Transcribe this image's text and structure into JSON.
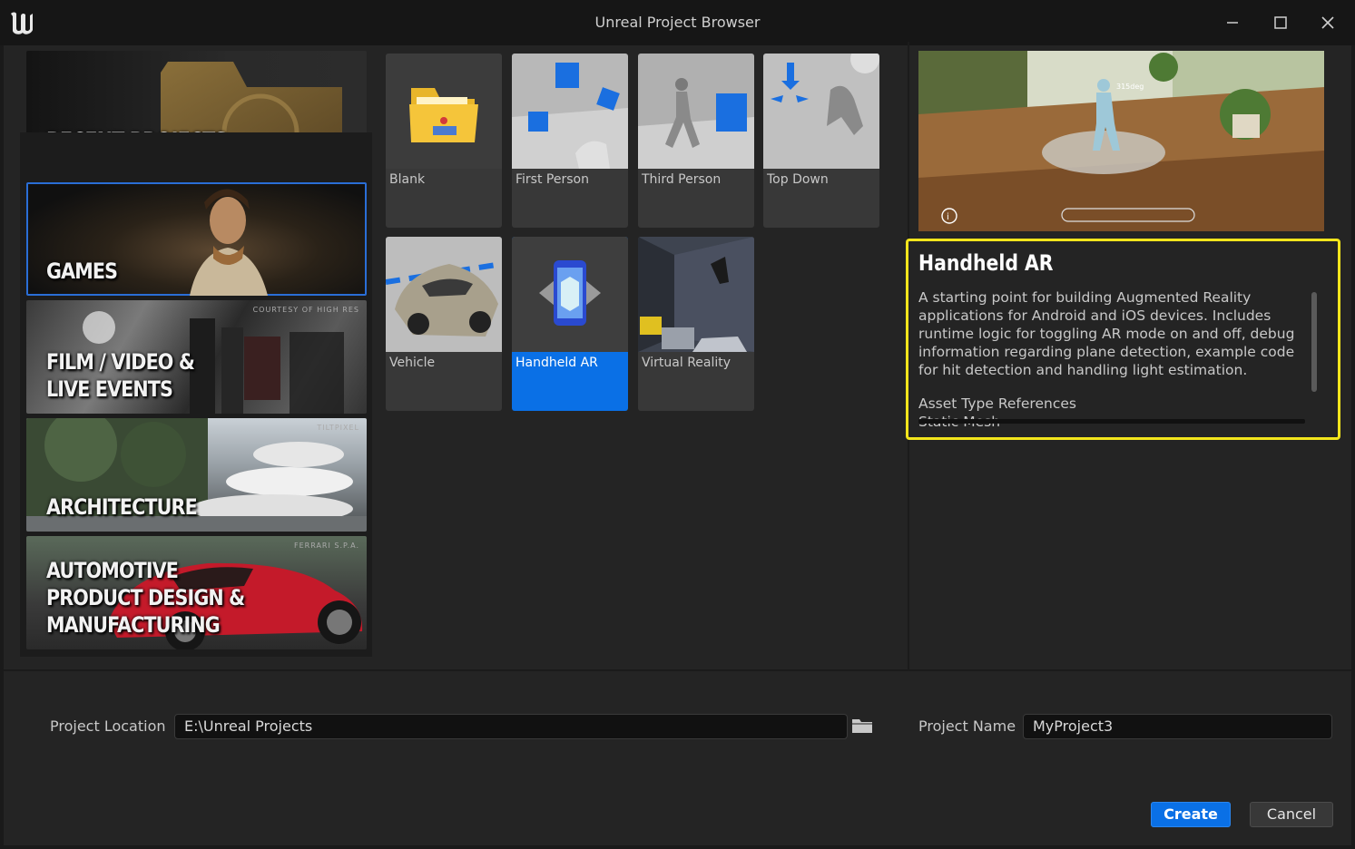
{
  "window": {
    "title": "Unreal Project Browser"
  },
  "categories": [
    {
      "label": "RECENT PROJECTS"
    },
    {
      "label": "GAMES"
    },
    {
      "label": "FILM / VIDEO & LIVE EVENTS",
      "line1": "FILM / VIDEO &",
      "line2": "LIVE EVENTS",
      "credit": "COURTESY OF HIGH RES"
    },
    {
      "label": "ARCHITECTURE",
      "credit": "TILTPIXEL"
    },
    {
      "label": "AUTOMOTIVE PRODUCT DESIGN & MANUFACTURING",
      "line1": "AUTOMOTIVE",
      "line2": "PRODUCT DESIGN &",
      "line3": "MANUFACTURING",
      "credit": "FERRARI S.P.A."
    }
  ],
  "templates": [
    {
      "label": "Blank"
    },
    {
      "label": "First Person"
    },
    {
      "label": "Third Person"
    },
    {
      "label": "Top Down"
    },
    {
      "label": "Vehicle"
    },
    {
      "label": "Handheld AR"
    },
    {
      "label": "Virtual Reality"
    }
  ],
  "details": {
    "title": "Handheld AR",
    "description": "A starting point for building Augmented Reality applications for Android and iOS devices. Includes runtime logic for toggling AR mode on and off, debug information regarding plane detection, example code for hit detection and handling light estimation.",
    "asset_refs_heading": "Asset Type References",
    "asset_refs_first": "Static Mesh",
    "preview_overlay": "315deg"
  },
  "bottom": {
    "location_label": "Project Location",
    "location_value": "E:\\Unreal Projects",
    "name_label": "Project Name",
    "name_value": "MyProject3",
    "create_label": "Create",
    "cancel_label": "Cancel"
  },
  "colors": {
    "accent": "#0a70e6",
    "highlight_border": "#f2e51c",
    "selected_category_border": "#2a6ed6"
  }
}
